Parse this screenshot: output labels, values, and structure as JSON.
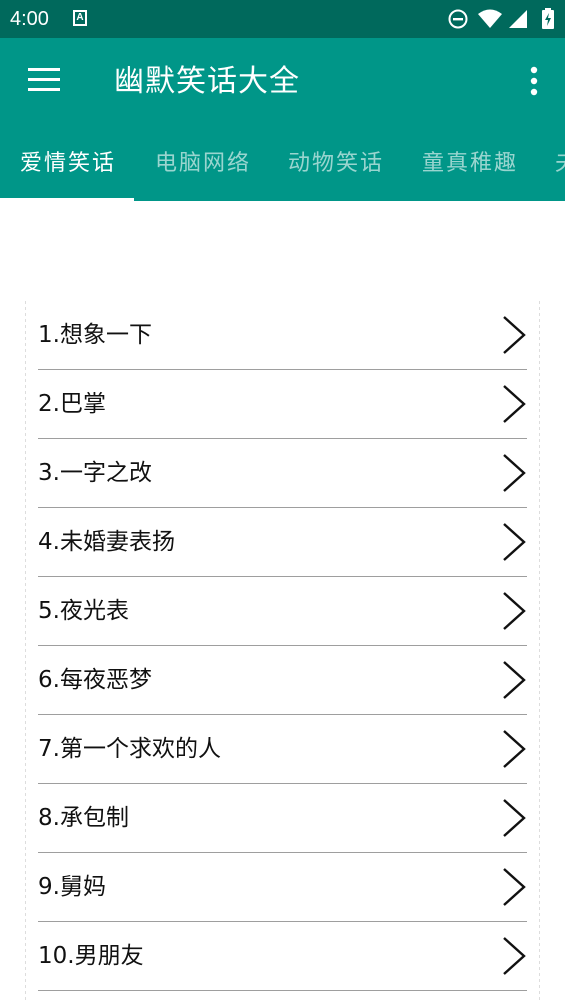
{
  "status_bar": {
    "time": "4:00",
    "a_icon_letter": "A",
    "icons": [
      "a-icon",
      "do-not-disturb-icon",
      "wifi-icon",
      "signal-icon",
      "battery-icon"
    ]
  },
  "app_bar": {
    "title": "幽默笑话大全",
    "icons": [
      "menu-icon",
      "more-vert-icon"
    ],
    "background_color": "#009688",
    "status_color": "#00695c"
  },
  "tabs": [
    {
      "label": "爱情笑话",
      "active": true
    },
    {
      "label": "电脑网络",
      "active": false
    },
    {
      "label": "动物笑话",
      "active": false
    },
    {
      "label": "童真稚趣",
      "active": false
    },
    {
      "label": "夫",
      "active": false
    }
  ],
  "list": {
    "items": [
      {
        "label": "1.想象一下"
      },
      {
        "label": "2.巴掌"
      },
      {
        "label": "3.一字之改"
      },
      {
        "label": "4.未婚妻表扬"
      },
      {
        "label": "5.夜光表"
      },
      {
        "label": "6.每夜恶梦"
      },
      {
        "label": "7.第一个求欢的人"
      },
      {
        "label": "8.承包制"
      },
      {
        "label": "9.舅妈"
      },
      {
        "label": "10.男朋友"
      }
    ],
    "item_icon": "chevron-right-icon"
  }
}
